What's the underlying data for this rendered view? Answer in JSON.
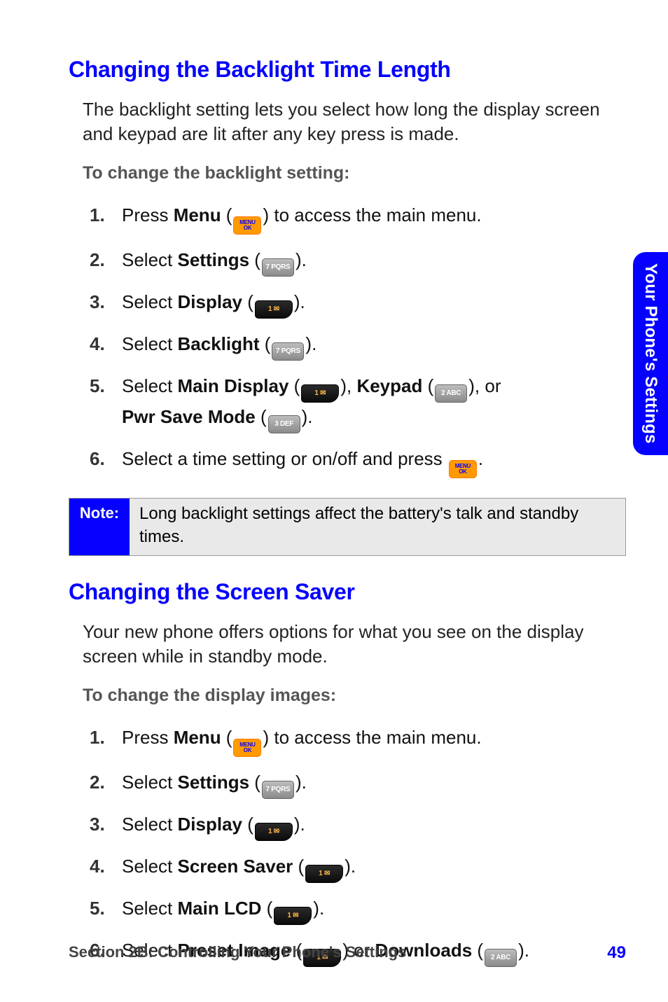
{
  "side_tab": {
    "label": "Your Phone's Settings"
  },
  "section1": {
    "heading": "Changing the Backlight Time Length",
    "intro": "The backlight setting lets you select how long the display screen and keypad are lit after any key press is made.",
    "subhead": "To change the backlight setting:",
    "steps": {
      "s1_a": "Press ",
      "s1_bold": "Menu",
      "s1_b": " (",
      "s1_c": ") to access the main menu.",
      "s2_a": "Select ",
      "s2_bold": "Settings",
      "s2_b": " (",
      "s2_c": ").",
      "s3_a": "Select ",
      "s3_bold": "Display",
      "s3_b": " (",
      "s3_c": ").",
      "s4_a": "Select ",
      "s4_bold": "Backlight",
      "s4_b": " (",
      "s4_c": ").",
      "s5_a": "Select ",
      "s5_bold1": "Main Display",
      "s5_b": " (",
      "s5_c": "), ",
      "s5_bold2": "Keypad",
      "s5_d": " (",
      "s5_e": "), or ",
      "s5_bold3": "Pwr Save Mode",
      "s5_f": " (",
      "s5_g": ").",
      "s6_a": "Select a time setting or on/off and press ",
      "s6_b": "."
    }
  },
  "note": {
    "label": "Note:",
    "text": "Long backlight settings affect the battery's talk and standby times."
  },
  "section2": {
    "heading": "Changing the Screen Saver",
    "intro": "Your new phone offers options for what you see on the display screen while in standby mode.",
    "subhead": "To change the display images:",
    "steps": {
      "s1_a": "Press ",
      "s1_bold": "Menu",
      "s1_b": " (",
      "s1_c": ") to access the main menu.",
      "s2_a": "Select ",
      "s2_bold": "Settings",
      "s2_b": " (",
      "s2_c": ").",
      "s3_a": "Select ",
      "s3_bold": "Display",
      "s3_b": " (",
      "s3_c": ").",
      "s4_a": "Select ",
      "s4_bold": "Screen Saver",
      "s4_b": " (",
      "s4_c": ").",
      "s5_a": "Select ",
      "s5_bold": "Main LCD",
      "s5_b": " (",
      "s5_c": ").",
      "s6_a": "Select ",
      "s6_bold1": "Preset Image",
      "s6_b": " (",
      "s6_c": ") or ",
      "s6_bold2": "Downloads",
      "s6_d": " (",
      "s6_e": ")."
    }
  },
  "keys": {
    "menu_l1": "MENU",
    "menu_l2": "OK",
    "k7": "7 PQRS",
    "k1": "1 ✉",
    "k2": "2 ABC",
    "k3": "3 DEF"
  },
  "footer": {
    "section": "Section 2B: Controlling Your Phone's Settings",
    "page": "49"
  }
}
